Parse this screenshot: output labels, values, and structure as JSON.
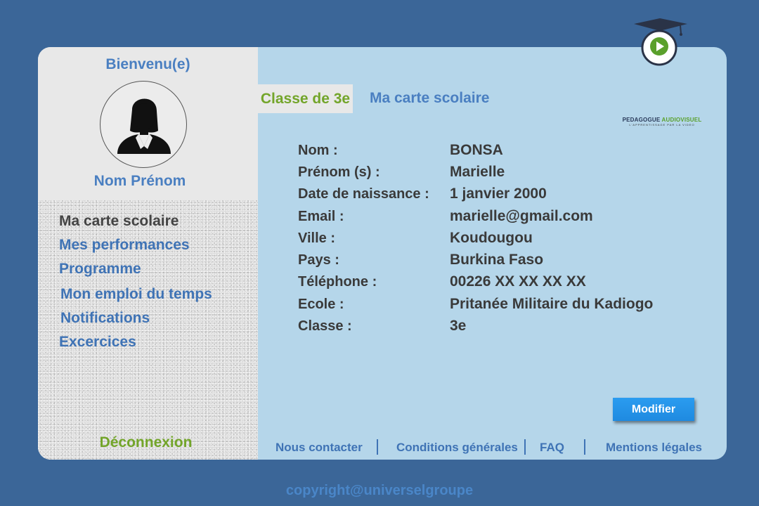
{
  "sidebar": {
    "welcome": "Bienvenu(e)",
    "user_name": "Nom Prénom",
    "items": [
      {
        "label": "Ma carte scolaire",
        "active": true
      },
      {
        "label": "Mes performances"
      },
      {
        "label": "Programme"
      },
      {
        "label": "Mon emploi du temps"
      },
      {
        "label": "Notifications"
      },
      {
        "label": "Excercices"
      }
    ],
    "logout": "Déconnexion"
  },
  "tabs": {
    "class_label": "Classe de 3e",
    "card_label": "Ma carte scolaire"
  },
  "profile": {
    "fields": [
      {
        "label": "Nom :",
        "value": "BONSA"
      },
      {
        "label": "Prénom (s) :",
        "value": "Marielle"
      },
      {
        "label": "Date de naissance :",
        "value": "1 janvier 2000"
      },
      {
        "label": "Email :",
        "value": "marielle@gmail.com"
      },
      {
        "label": "Ville :",
        "value": "Koudougou"
      },
      {
        "label": "Pays :",
        "value": "Burkina Faso"
      },
      {
        "label": "Téléphone :",
        "value": "00226 XX XX XX XX"
      },
      {
        "label": "Ecole :",
        "value": "Pritanée Militaire du Kadiogo"
      },
      {
        "label": "Classe :",
        "value": "3e"
      }
    ],
    "edit_button": "Modifier"
  },
  "footer": {
    "links": [
      "Nous contacter",
      "Conditions générales",
      "FAQ",
      "Mentions légales"
    ]
  },
  "logo": {
    "name_part1": "PEDAGOGUE",
    "name_part2": "AUDIOVISUEL",
    "tagline": "L'APPRENTISSAGE PAR LA VIDEO",
    "brand_color": "#5aa02c"
  },
  "copyright": "copyright@universelgroupe",
  "colors": {
    "background": "#3b6698",
    "panel": "#b5d6ea",
    "accent_green": "#73a52a",
    "link_blue": "#4a7fc1",
    "button_blue": "#1f8ae0"
  }
}
